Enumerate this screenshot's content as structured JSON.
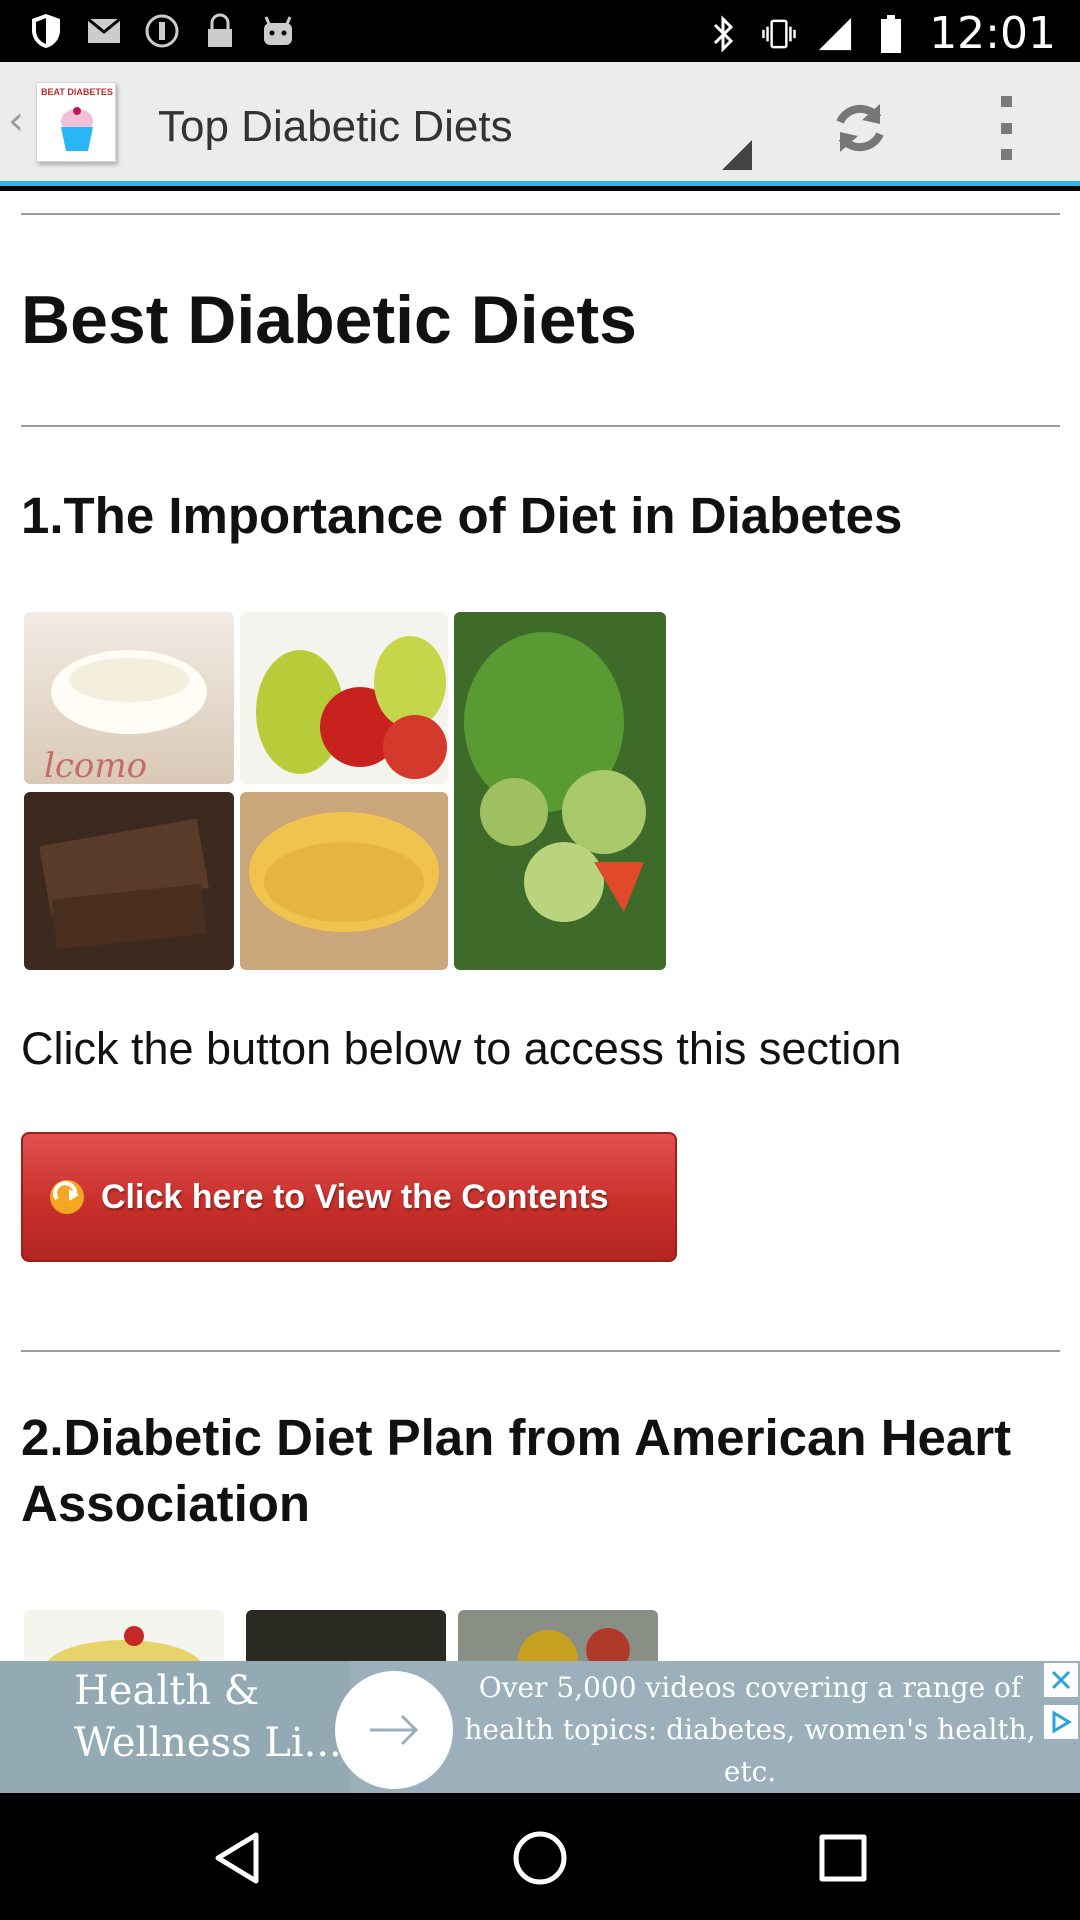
{
  "status_bar": {
    "time": "12:01"
  },
  "action_bar": {
    "app_icon_text": "BEAT DIABETES",
    "title": "Top Diabetic Diets"
  },
  "content": {
    "heading": "Best Diabetic Diets",
    "section1_title": "1.The Importance of Diet in Diabetes",
    "instruction": "Click the button below to access this section",
    "view_button_label": "Click here to View the Contents",
    "section2_title": "2.Diabetic Diet Plan from American Heart Association"
  },
  "ad": {
    "headline": "Health & Wellness Li...",
    "body": "Over 5,000 videos covering a range of health topics: diabetes, women's health, etc."
  },
  "colors": {
    "accent": "#33b5e5",
    "button_red": "#c9302c"
  }
}
